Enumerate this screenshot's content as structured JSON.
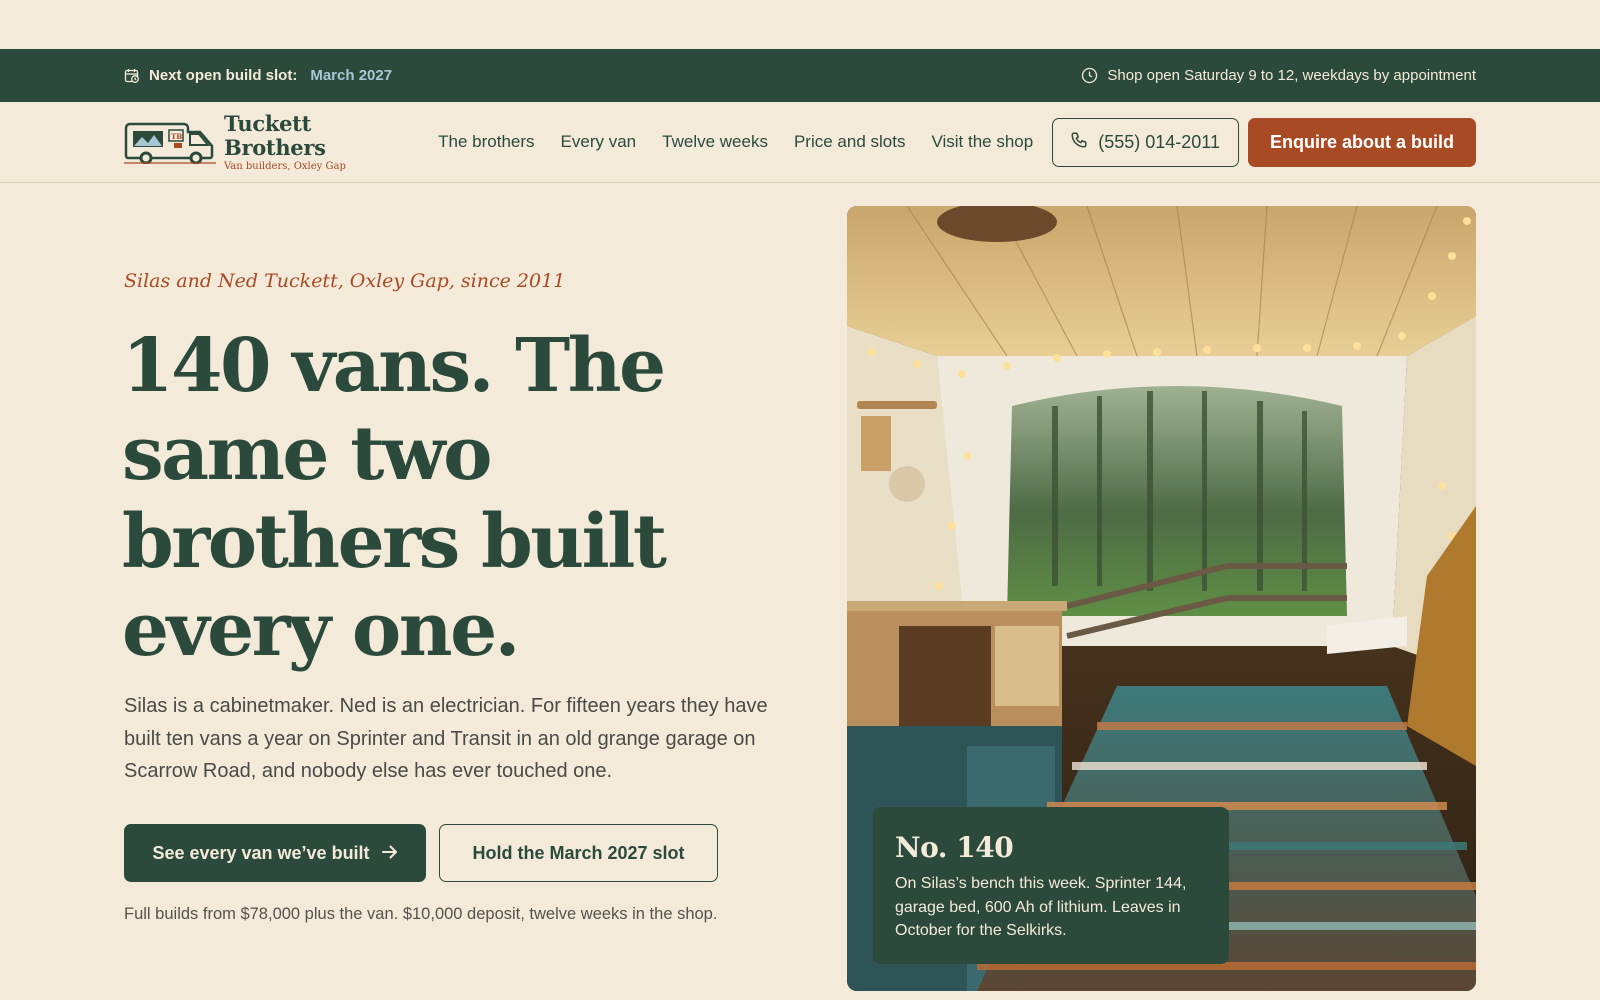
{
  "announce": {
    "slot_label": "Next open build slot:",
    "slot_value": "March 2027",
    "hours": "Shop open Saturday 9 to 12, weekdays by appointment"
  },
  "header": {
    "brand_name": "Tuckett Brothers",
    "brand_sub": "Van builders, Oxley Gap",
    "nav": [
      "The brothers",
      "Every van",
      "Twelve weeks",
      "Price and slots",
      "Visit the shop"
    ],
    "phone": "(555) 014-2011",
    "cta": "Enquire about a build"
  },
  "hero": {
    "eyebrow": "Silas and Ned Tuckett, Oxley Gap, since 2011",
    "headline": "140 vans. The same two brothers built every one.",
    "lede": "Silas is a cabinetmaker. Ned is an electrician. For fifteen years they have built ten vans a year on Sprinter and Transit in an old grange garage on Scarrow Road, and nobody else has ever touched one.",
    "primary_button": "See every van we’ve built",
    "secondary_button": "Hold the March 2027 slot",
    "price_note": "Full builds from $78,000 plus the van. $10,000 deposit, twelve weeks in the shop."
  },
  "photo_card": {
    "title": "No. 140",
    "text": "On Silas’s bench this week. Sprinter 144, garage bed, 600 Ah of lithium. Leaves in October for the Selkirks."
  },
  "colors": {
    "background": "#f3ead9",
    "forest": "#2c4a3b",
    "rust": "#a84a24",
    "slot_accent": "#a9c6d4"
  },
  "icons": {
    "announce_left": "calendar-clock-icon",
    "announce_right": "clock-icon",
    "phone": "phone-icon",
    "primary_arrow": "arrow-right-icon",
    "logo": "van-logo-icon"
  }
}
